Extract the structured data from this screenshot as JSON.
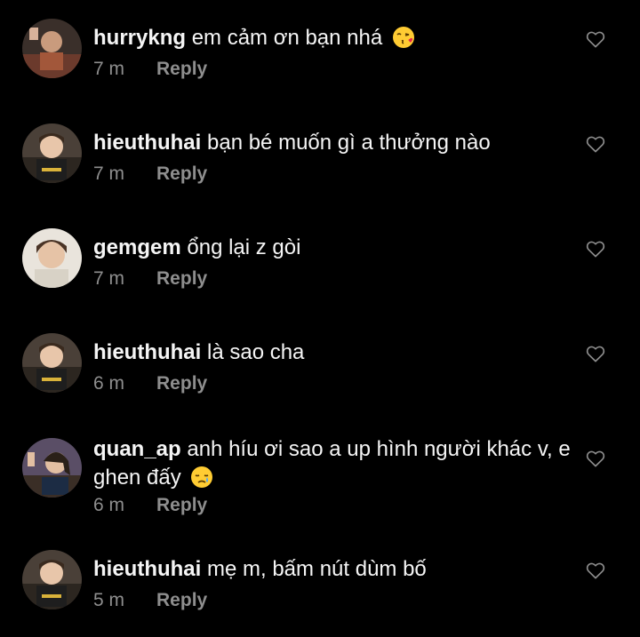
{
  "comments": [
    {
      "username": "hurrykng",
      "message": "em cảm ơn bạn nhá",
      "emoji": "kissing-heart-emoji",
      "time": "7 m",
      "reply_label": "Reply"
    },
    {
      "username": "hieuthuhai",
      "message": "bạn bé muốn gì a thưởng nào",
      "time": "7 m",
      "reply_label": "Reply"
    },
    {
      "username": "gemgem",
      "message": "ổng lại z gòi",
      "time": "7 m",
      "reply_label": "Reply"
    },
    {
      "username": "hieuthuhai",
      "message": "là sao cha",
      "time": "6 m",
      "reply_label": "Reply"
    },
    {
      "username": "quan_ap",
      "message": "anh híu ơi sao a up hình người khác v, e ghen đấy",
      "emoji": "sad-tear-emoji",
      "time": "6 m",
      "reply_label": "Reply"
    },
    {
      "username": "hieuthuhai",
      "message": "mẹ m, bấm nút dùm bố",
      "time": "5 m",
      "reply_label": "Reply"
    }
  ],
  "icons": {
    "like": "heart-outline-icon"
  },
  "colors": {
    "background": "#000000",
    "text": "#f5f5f5",
    "secondary_text": "#8e8e8e",
    "emoji_yellow": "#ffcc33"
  }
}
